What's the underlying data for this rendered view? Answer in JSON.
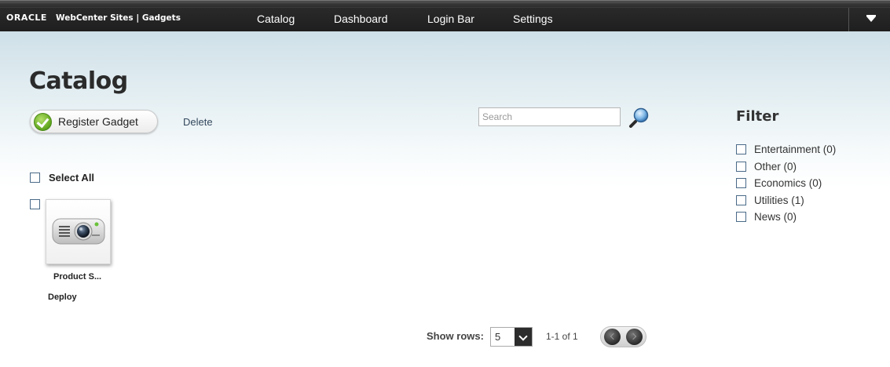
{
  "header": {
    "brand_oracle": "ORACLE",
    "brand_product": "WebCenter Sites | Gadgets",
    "nav": [
      {
        "label": "Catalog"
      },
      {
        "label": "Dashboard"
      },
      {
        "label": "Login Bar"
      },
      {
        "label": "Settings"
      }
    ],
    "menu_icon": "chevron-down-menu-icon"
  },
  "main": {
    "title": "Catalog",
    "register_label": "Register Gadget",
    "delete_label": "Delete",
    "search": {
      "placeholder": "Search",
      "value": ""
    },
    "select_all_label": "Select All",
    "gadgets": [
      {
        "name": "Product S...",
        "action": "Deploy",
        "icon": "projector-icon",
        "checked": false
      }
    ]
  },
  "pagination": {
    "show_rows_label": "Show rows:",
    "rows_value": "5",
    "range_text": "1-1 of 1"
  },
  "filter": {
    "title": "Filter",
    "items": [
      {
        "label": "Entertainment (0)",
        "checked": false
      },
      {
        "label": "Other (0)",
        "checked": false
      },
      {
        "label": "Economics (0)",
        "checked": false
      },
      {
        "label": "Utilities (1)",
        "checked": false
      },
      {
        "label": "News (0)",
        "checked": false
      }
    ]
  },
  "colors": {
    "topbar": "#1e1e1e",
    "accent_check": "#5fa51c",
    "page_gradient_top": "#cfe0e8"
  }
}
